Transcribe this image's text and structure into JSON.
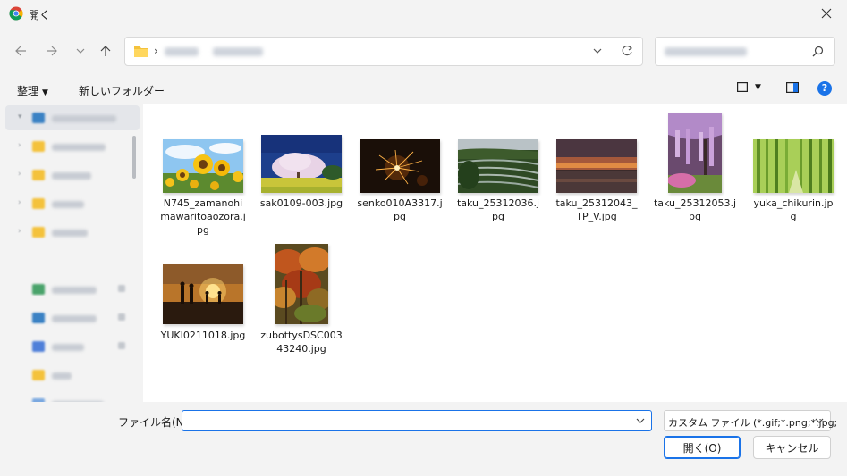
{
  "window": {
    "title": "開く"
  },
  "navigation": {
    "back_icon": "arrow-left-icon",
    "forward_icon": "arrow-right-icon",
    "recent_icon": "chevron-down-icon",
    "up_icon": "arrow-up-icon",
    "refresh_icon": "refresh-icon",
    "separator": "›"
  },
  "search": {
    "icon": "search-icon"
  },
  "commandbar": {
    "organize_label": "整理",
    "new_folder_label": "新しいフォルダー",
    "help_label": "?"
  },
  "files": [
    {
      "name": "N745_zamanohimawaritoaozora.jpg"
    },
    {
      "name": "sak0109-003.jpg"
    },
    {
      "name": "senko010A3317.jpg"
    },
    {
      "name": "taku_25312036.jpg"
    },
    {
      "name": "taku_25312043_TP_V.jpg"
    },
    {
      "name": "taku_25312053.jpg"
    },
    {
      "name": "yuka_chikurin.jpg"
    },
    {
      "name": "YUKI0211018.jpg"
    },
    {
      "name": "zubottysDSC00343240.jpg"
    }
  ],
  "bottom": {
    "filename_label": "ファイル名(N):",
    "filename_value": "",
    "filter_value": "カスタム ファイル (*.gif;*.png;*.jpg;",
    "open_label": "開く(O)",
    "cancel_label": "キャンセル"
  },
  "colors": {
    "accent": "#1a73e8",
    "folder": "#f4c23c"
  }
}
